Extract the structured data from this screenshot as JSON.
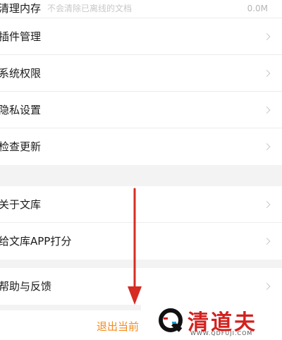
{
  "settings": {
    "clear_cache": {
      "label": "清理内存",
      "hint": "不会清除已离线的文档",
      "value": "0.0M"
    },
    "group1": [
      {
        "label": "插件管理"
      },
      {
        "label": "系统权限"
      },
      {
        "label": "隐私设置"
      },
      {
        "label": "检查更新"
      }
    ],
    "group2": [
      {
        "label": "关于文库"
      },
      {
        "label": "给文库APP打分"
      }
    ],
    "group3": [
      {
        "label": "帮助与反馈"
      }
    ],
    "logout": "退出当前"
  },
  "watermark": {
    "name": "清道夫",
    "url": "WWW.QDFUJI.COM"
  },
  "colors": {
    "accent": "#f58a1c",
    "arrow": "#d62b22",
    "watermark": "#d3201e"
  }
}
